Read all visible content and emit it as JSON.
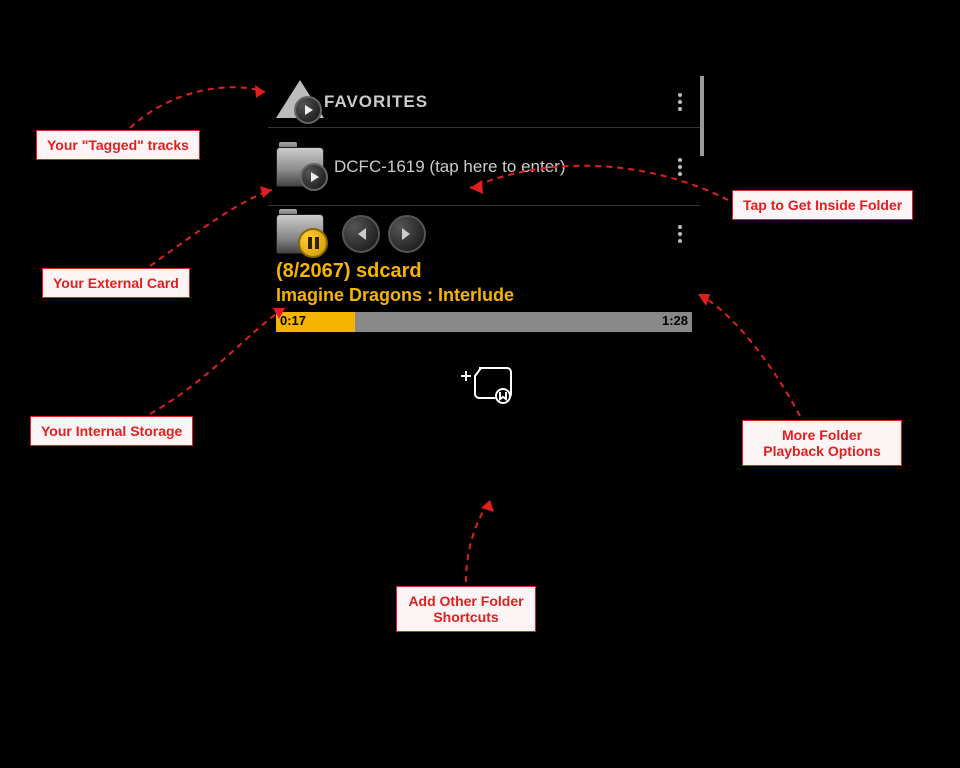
{
  "header": {
    "title": "FAVORITES"
  },
  "folder_row": {
    "label": "DCFC-1619 (tap here to enter)"
  },
  "now_playing": {
    "counter": "(8/2067)  sdcard",
    "track": "Imagine Dragons : Interlude",
    "elapsed": "0:17",
    "total": "1:28"
  },
  "callouts": {
    "tagged": "Your \"Tagged\" tracks",
    "external": "Your External Card",
    "internal": "Your Internal Storage",
    "inside": "Tap to Get Inside Folder",
    "more_options": "More Folder Playback Options",
    "add_shortcut": "Add Other Folder Shortcuts"
  }
}
